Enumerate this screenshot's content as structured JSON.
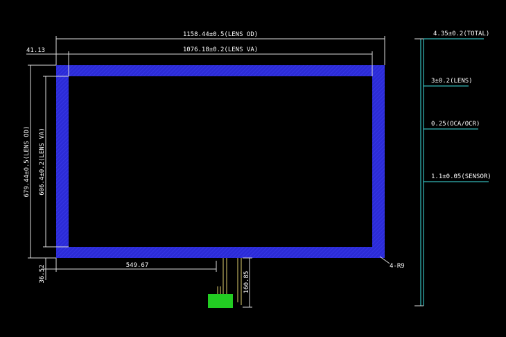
{
  "colors": {
    "background": "#000000",
    "bezel": "#2b2bd6",
    "bezel_hatch": "#3a3aea",
    "dimension_line": "#dcdcdc",
    "fpc_line": "#e0d070",
    "connector": "#22cc22",
    "layer_line": "#3fe4e4"
  },
  "front_view": {
    "dim_lens_od_width": "1158.44±0.5(LENS OD)",
    "dim_lens_va_width": "1076.18±0.2(LENS VA)",
    "dim_left_offset": "41.13",
    "dim_lens_od_height": "679.44±0.5(LENS OD)",
    "dim_lens_va_height": "606.4±0.2(LENS VA)",
    "dim_bottom_offset": "36.52",
    "dim_fpc_position": "549.67",
    "dim_fpc_length": "160.85",
    "corner_radius_label": "4-R9"
  },
  "side_view": {
    "layers": [
      {
        "label": "4.35±0.2(TOTAL)"
      },
      {
        "label": "3±0.2(LENS)"
      },
      {
        "label": "0.25(OCA/OCR)"
      },
      {
        "label": "1.1±0.05(SENSOR)"
      }
    ]
  }
}
